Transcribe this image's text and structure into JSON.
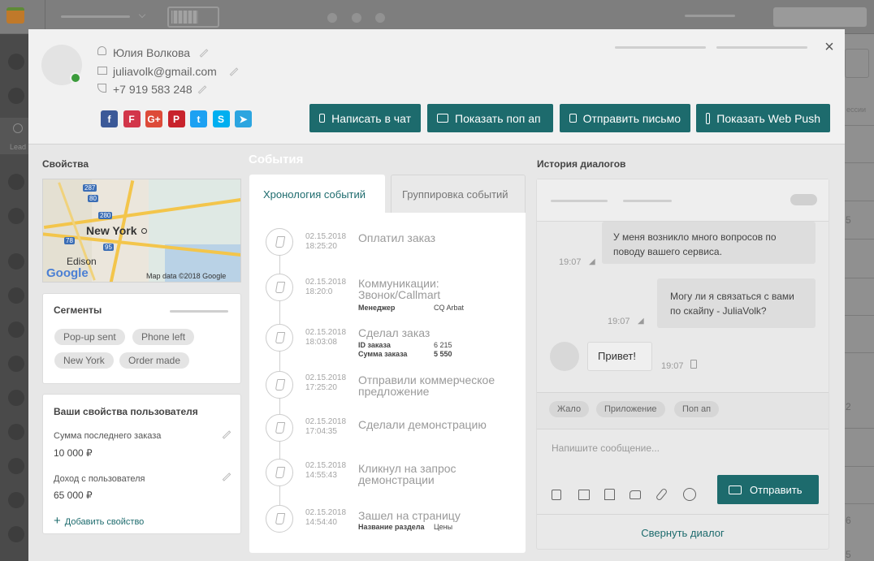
{
  "contact": {
    "name": "Юлия Волкова",
    "email": "juliavolk@gmail.com",
    "phone": "+7 919 583 248"
  },
  "social": [
    {
      "icon": "facebook-icon",
      "glyph": "f",
      "color": "#3b5998"
    },
    {
      "icon": "flamp-icon",
      "glyph": "F",
      "color": "#d2364a"
    },
    {
      "icon": "google-plus-icon",
      "glyph": "G+",
      "color": "#dd4b39"
    },
    {
      "icon": "pinterest-icon",
      "glyph": "P",
      "color": "#c8232c"
    },
    {
      "icon": "twitter-icon",
      "glyph": "t",
      "color": "#1da1f2"
    },
    {
      "icon": "skype-icon",
      "glyph": "S",
      "color": "#00aff0"
    },
    {
      "icon": "telegram-icon",
      "glyph": "➤",
      "color": "#2ca5e0"
    }
  ],
  "actions": {
    "chat": "Написать в чат",
    "popup": "Показать поп ап",
    "email": "Отправить письмо",
    "webpush": "Показать Web Push"
  },
  "properties": {
    "title": "Свойства",
    "map": {
      "city": "New York",
      "area": "Edison",
      "google": "Google",
      "attribution": "Map data ©2018 Google",
      "route1": "287",
      "route2": "80",
      "route3": "280",
      "route4": "78",
      "route5": "95"
    }
  },
  "segments": {
    "title": "Сегменты",
    "tags": [
      "Pop-up sent",
      "Phone left",
      "New York",
      "Order made"
    ]
  },
  "user_props": {
    "title": "Ваши свойства пользователя",
    "items": [
      {
        "label": "Сумма последнего заказа",
        "value": "10 000 ₽"
      },
      {
        "label": "Доход с пользователя",
        "value": "65 000 ₽"
      }
    ],
    "add": "Добавить свойство"
  },
  "events": {
    "title": "События",
    "tab_timeline": "Хронология событий",
    "tab_group": "Группировка событий",
    "items": [
      {
        "date": "02.15.2018",
        "time": "18:25:20",
        "title": "Оплатил заказ"
      },
      {
        "date": "02.15.2018",
        "time": "18:20:0",
        "title": "Коммуникации: Звонок/Callmart",
        "meta": [
          {
            "label": "Менеджер",
            "value": "CQ Arbat"
          }
        ]
      },
      {
        "date": "02.15.2018",
        "time": "18:03:08",
        "title": "Сделал заказ",
        "meta": [
          {
            "label": "ID заказа",
            "value": "6 215"
          },
          {
            "label": "Сумма заказа",
            "value": "5 550"
          }
        ]
      },
      {
        "date": "02.15.2018",
        "time": "17:25:20",
        "title": "Отправили коммерческое предложение"
      },
      {
        "date": "02.15.2018",
        "time": "17:04:35",
        "title": "Сделали демонстрацию"
      },
      {
        "date": "02.15.2018",
        "time": "14:55:43",
        "title": "Кликнул на запрос демонстрации"
      },
      {
        "date": "02.15.2018",
        "time": "14:54:40",
        "title": "Зашел на страницу",
        "meta": [
          {
            "label": "Название раздела",
            "value": "Цены"
          }
        ]
      }
    ]
  },
  "dialog": {
    "title": "История диалогов",
    "messages": [
      {
        "text": "У меня возникло много вопросов по поводу вашего сервиса.",
        "time": "19:07"
      },
      {
        "text": "Могу ли я связаться с вами по скайпу - JuliaVolk?",
        "time": "19:07"
      },
      {
        "text": "Привет!",
        "time": "19:07"
      }
    ],
    "quick_tags": [
      "Жало",
      "Приложение",
      "Поп ап"
    ],
    "placeholder": "Напишите сообщение...",
    "send": "Отправить",
    "collapse": "Свернуть диалог"
  },
  "background": {
    "nav_label": "Lead",
    "sessions": "ессии",
    "numbers": [
      "5",
      "2",
      "6",
      "5"
    ]
  }
}
